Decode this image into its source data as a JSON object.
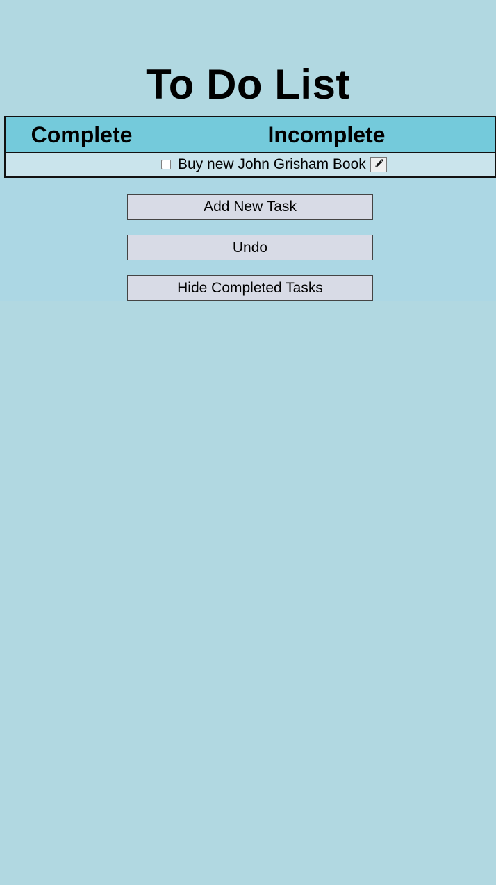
{
  "page": {
    "title": "To Do List"
  },
  "table": {
    "headers": {
      "complete": "Complete",
      "incomplete": "Incomplete"
    },
    "complete_tasks": [],
    "incomplete_tasks": [
      {
        "label": "Buy new John Grisham Book",
        "checked": false,
        "edit_icon": "pencil-icon"
      }
    ]
  },
  "buttons": {
    "add_new_task": "Add New Task",
    "undo": "Undo",
    "hide_completed_tasks": "Hide Completed Tasks"
  },
  "colors": {
    "page_background": "#b1d8e1",
    "header_background": "#74cadb",
    "cell_background": "#cae4ec",
    "button_background": "#d8dbe6"
  }
}
